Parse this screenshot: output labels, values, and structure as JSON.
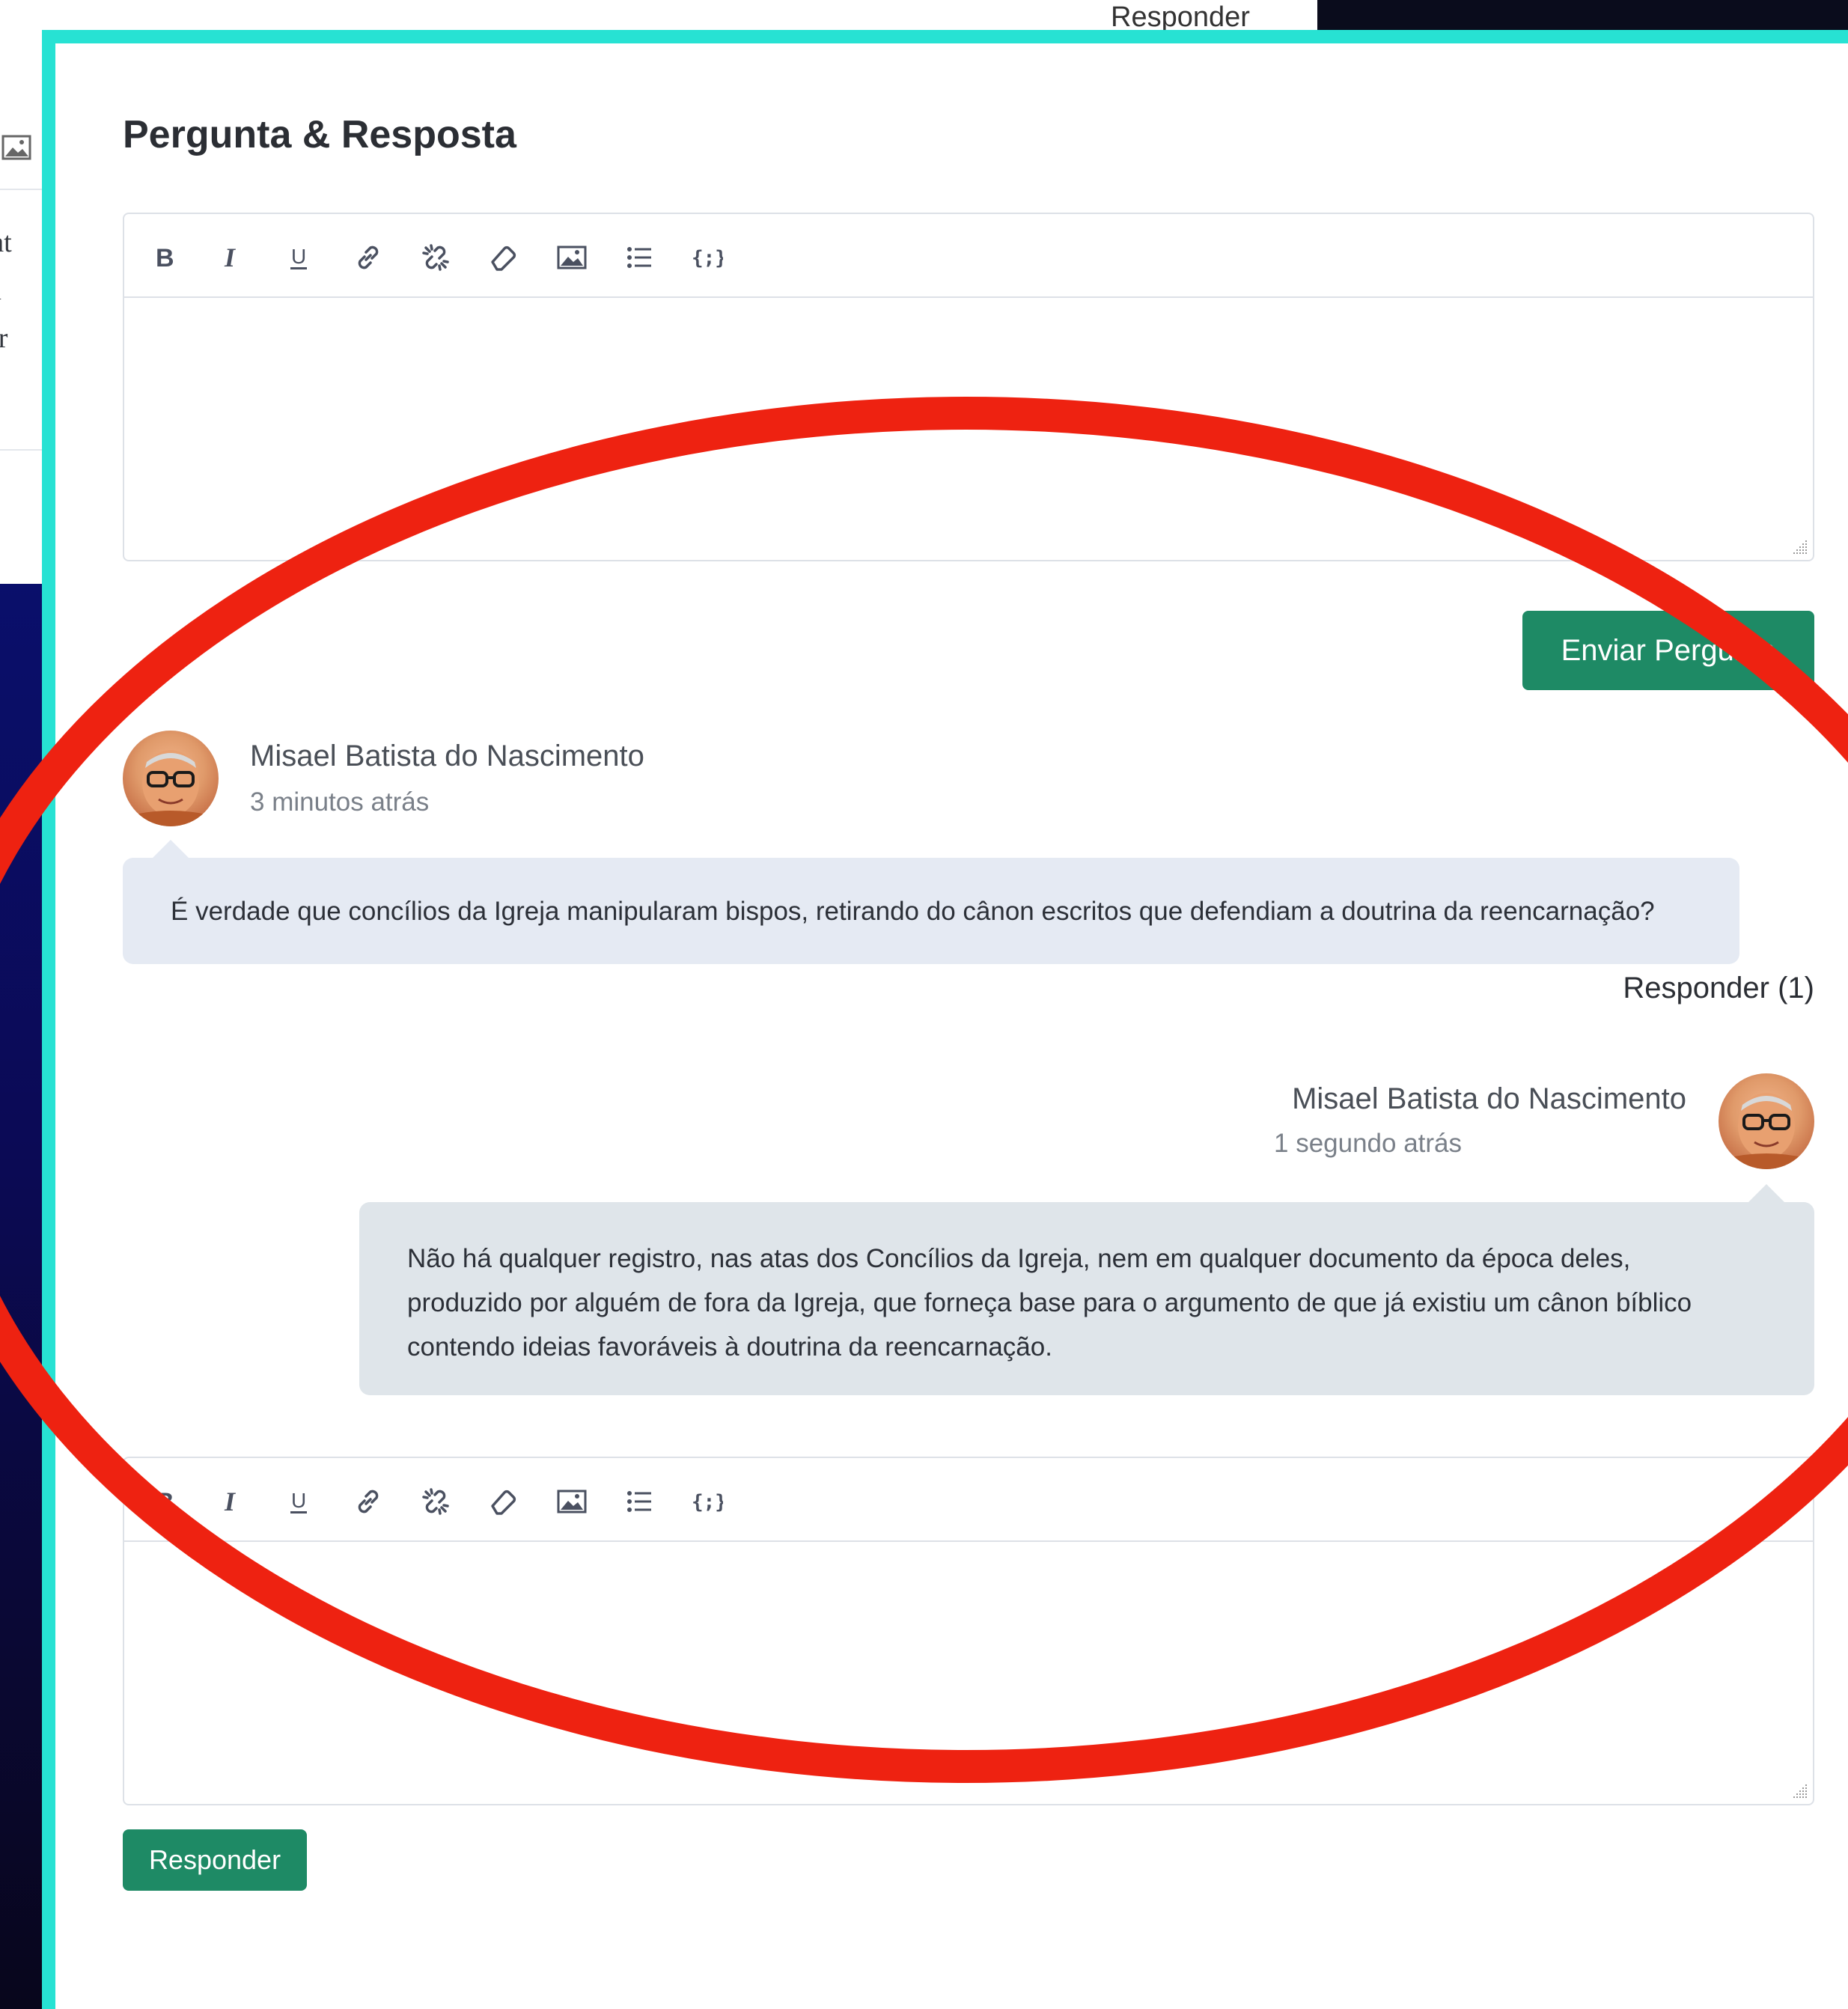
{
  "background": {
    "behind_window_lines": [
      "s at",
      "qu",
      "car"
    ],
    "behind_top_label": "Responder"
  },
  "panel": {
    "title": "Pergunta & Resposta",
    "accent_color": "#27e2d3",
    "button_color": "#1e8a65"
  },
  "toolbar_icons": [
    "bold-icon",
    "italic-icon",
    "underline-icon",
    "link-icon",
    "unlink-icon",
    "eraser-icon",
    "image-icon",
    "bullet-list-icon",
    "code-icon"
  ],
  "question_editor": {
    "submit_label": "Enviar Pergunta"
  },
  "question": {
    "author": "Misael Batista do Nascimento",
    "time": "3 minutos atrás",
    "text": "É verdade que concílios da Igreja manipularam bispos, retirando do cânon escritos que defendiam a doutrina da reencarnação?",
    "reply_label": "Responder (1)"
  },
  "answer": {
    "author": "Misael Batista do Nascimento",
    "time": "1 segundo atrás",
    "lines": [
      "Não há qualquer registro, nas atas dos Concílios da Igreja, nem em qualquer documento da época deles,",
      "produzido por alguém de fora da Igreja, que forneça base para o argumento de que já existiu um cânon bíblico",
      "contendo ideias favoráveis à doutrina da reencarnação."
    ]
  },
  "reply_editor": {
    "submit_label": "Responder"
  },
  "annotation": {
    "shape": "ellipse",
    "color": "#ee2211"
  }
}
